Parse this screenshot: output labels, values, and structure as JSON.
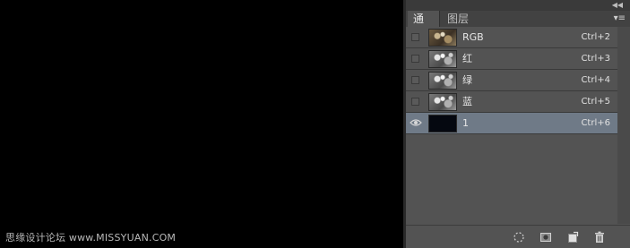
{
  "watermark": "思缘设计论坛 www.MISSYUAN.COM",
  "panel": {
    "tabs": [
      {
        "label": "通道",
        "active": true
      },
      {
        "label": "图层",
        "active": false
      }
    ],
    "collapse_icon": "double-chevron-left-icon",
    "menu_icon": "panel-menu-icon"
  },
  "channels": [
    {
      "name": "RGB",
      "shortcut": "Ctrl+2",
      "visible": false,
      "thumb": "rgb",
      "selected": false
    },
    {
      "name": "红",
      "shortcut": "Ctrl+3",
      "visible": false,
      "thumb": "gray",
      "selected": false
    },
    {
      "name": "绿",
      "shortcut": "Ctrl+4",
      "visible": false,
      "thumb": "gray",
      "selected": false
    },
    {
      "name": "蓝",
      "shortcut": "Ctrl+5",
      "visible": false,
      "thumb": "gray",
      "selected": false
    },
    {
      "name": "1",
      "shortcut": "Ctrl+6",
      "visible": true,
      "thumb": "dark",
      "selected": true
    }
  ],
  "bottom_tools": [
    {
      "name": "load-selection-icon"
    },
    {
      "name": "save-selection-icon"
    },
    {
      "name": "new-channel-icon"
    },
    {
      "name": "delete-channel-icon"
    }
  ],
  "colors": {
    "panel_bg": "#535353",
    "selected_row": "#6f7a87",
    "canvas": "#000000"
  }
}
